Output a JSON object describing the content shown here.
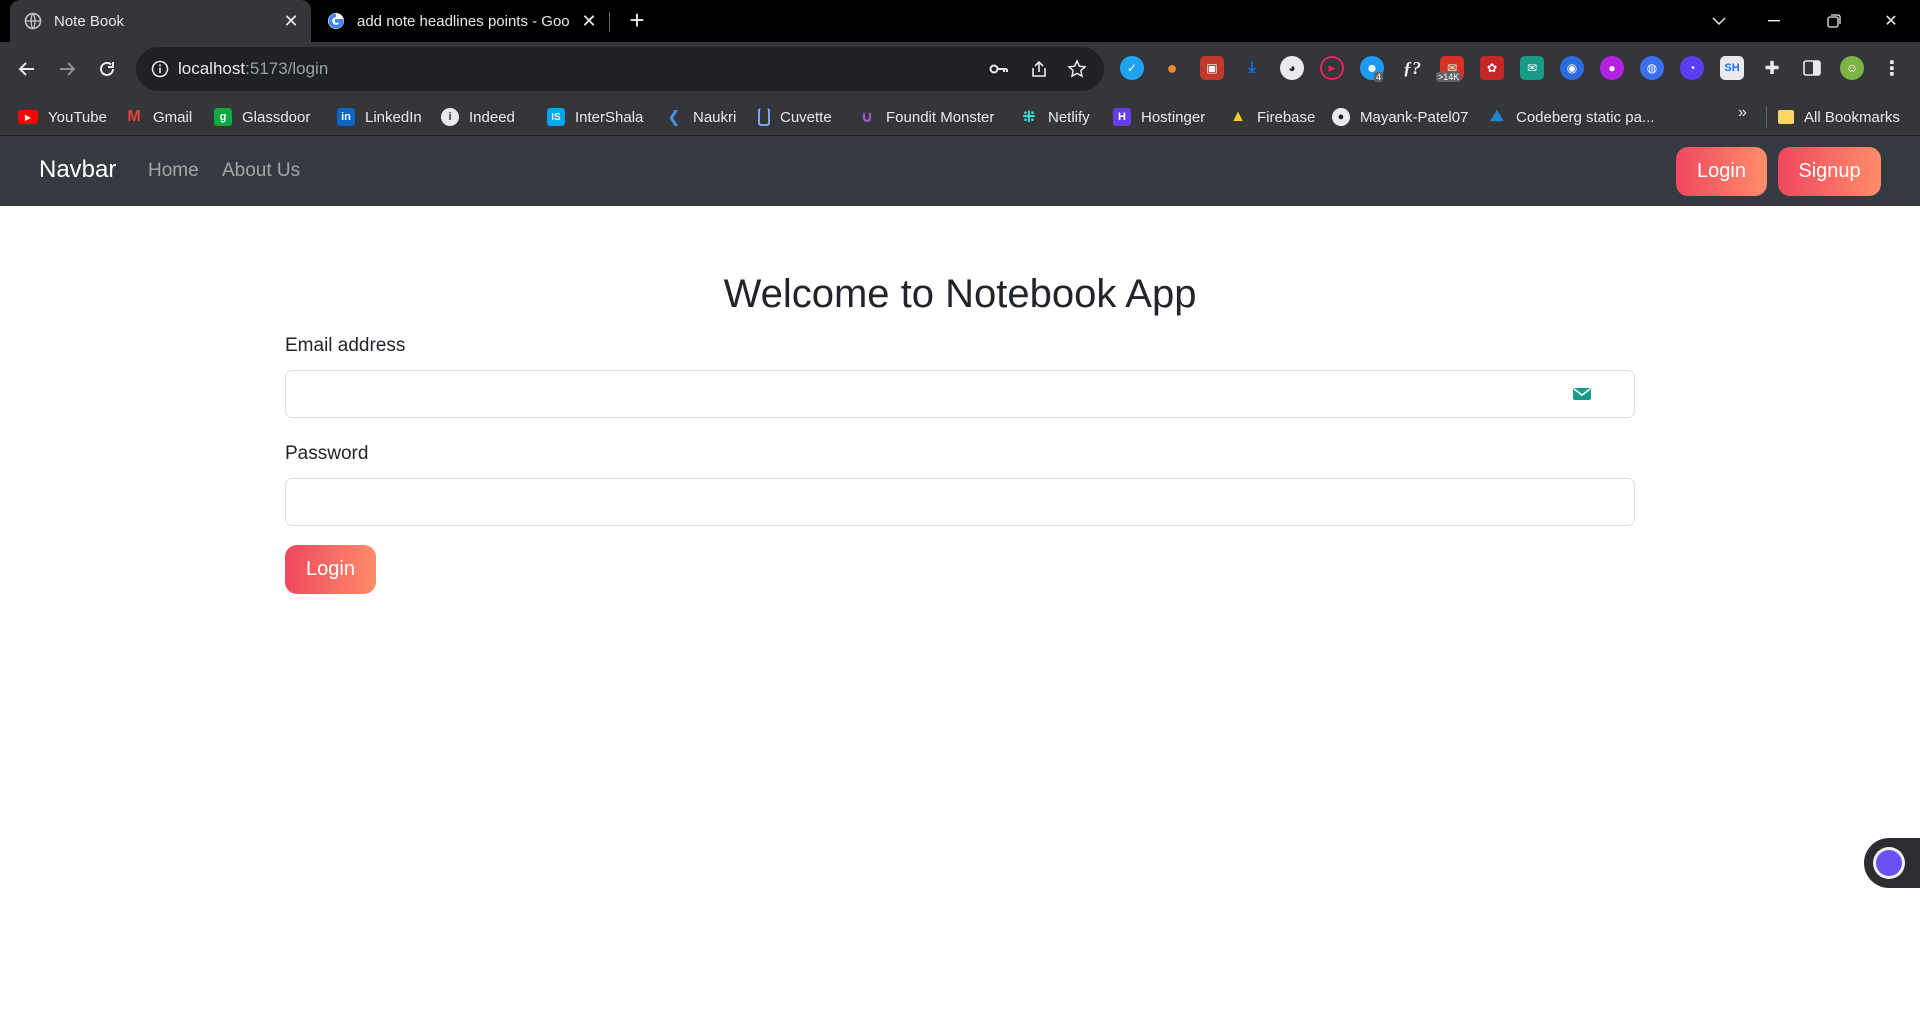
{
  "browser": {
    "tabs": [
      {
        "title": "Note Book",
        "icon": "globe-icon",
        "active": true
      },
      {
        "title": "add note headlines points - Goo",
        "icon": "google-icon",
        "active": false
      }
    ],
    "url": {
      "host": "localhost",
      "path": ":5173/login"
    },
    "bookmarks": [
      {
        "label": "YouTube",
        "icon": "youtube-icon",
        "color": "#ff0000"
      },
      {
        "label": "Gmail",
        "icon": "gmail-icon",
        "color": "#ea4335"
      },
      {
        "label": "Glassdoor",
        "icon": "glassdoor-icon",
        "color": "#0caa41"
      },
      {
        "label": "LinkedIn",
        "icon": "linkedin-icon",
        "color": "#0a66c2"
      },
      {
        "label": "Indeed",
        "icon": "info-icon",
        "color": "#ffffff"
      },
      {
        "label": "InterShala",
        "icon": "internshala-icon",
        "color": "#00a5ec"
      },
      {
        "label": "Naukri",
        "icon": "naukri-icon",
        "color": "#4a90e2"
      },
      {
        "label": "Cuvette",
        "icon": "cuvette-icon",
        "color": "#7aa7ff"
      },
      {
        "label": "Foundit Monster",
        "icon": "foundit-icon",
        "color": "#9b59d0"
      },
      {
        "label": "Netlify",
        "icon": "netlify-icon",
        "color": "#32e6e2"
      },
      {
        "label": "Hostinger",
        "icon": "hostinger-icon",
        "color": "#673de6"
      },
      {
        "label": "Firebase",
        "icon": "firebase-icon",
        "color": "#ffca28"
      },
      {
        "label": "Mayank-Patel07",
        "icon": "github-icon",
        "color": "#ffffff"
      },
      {
        "label": "Codeberg static pa...",
        "icon": "codeberg-icon",
        "color": "#2185d0"
      },
      {
        "label": "All Bookmarks",
        "icon": "folder-icon",
        "color": "#fdd663"
      }
    ],
    "extension_badges": {
      "ghost_count": "4",
      "mail_count": ">14K"
    }
  },
  "app": {
    "navbar": {
      "brand": "Navbar",
      "links": [
        "Home",
        "About Us"
      ],
      "login_label": "Login",
      "signup_label": "Signup"
    },
    "form": {
      "heading": "Welcome to Notebook App",
      "email_label": "Email address",
      "email_value": "",
      "password_label": "Password",
      "password_value": "",
      "submit_label": "Login"
    }
  },
  "colors": {
    "navbar_bg": "#343a40",
    "button_gradient_start": "#f0475f",
    "button_gradient_end": "#fe8d6a",
    "chrome_dark": "#35363a"
  }
}
